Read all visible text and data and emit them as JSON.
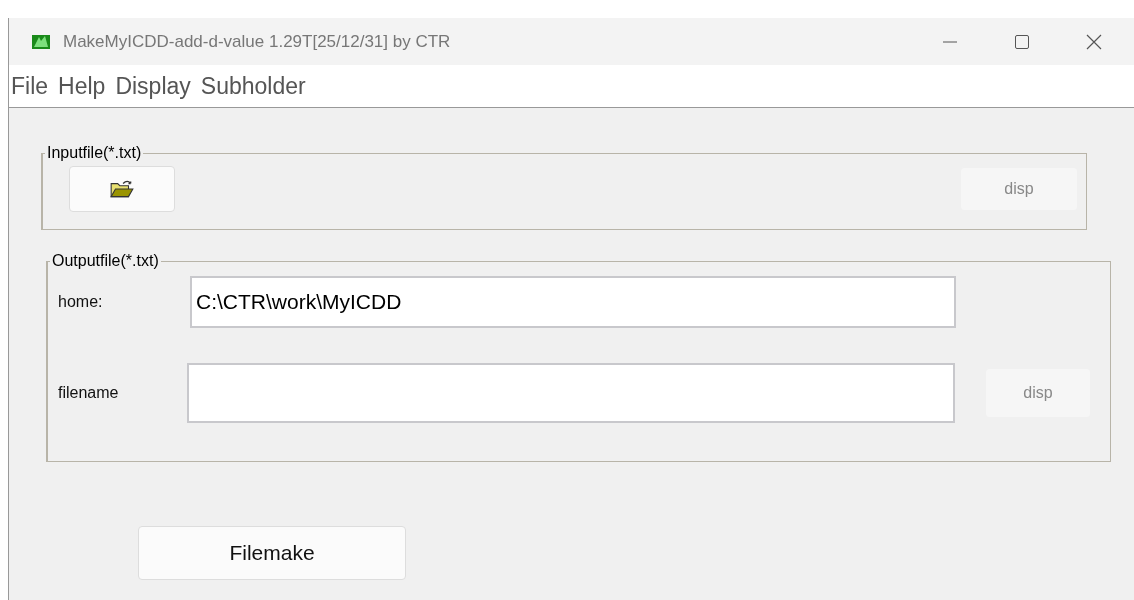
{
  "window": {
    "title": "MakeMyICDD-add-d-value 1.29T[25/12/31] by CTR"
  },
  "menu": [
    "File",
    "Help",
    "Display",
    "Subholder"
  ],
  "input_group": {
    "legend": "Inputfile(*.txt)",
    "disp_button": {
      "label": "disp",
      "disabled": true
    }
  },
  "output_group": {
    "legend": "Outputfile(*.txt)",
    "home": {
      "label": "home:",
      "value": "C:\\CTR\\work\\MyICDD"
    },
    "filename": {
      "label": "filename"
    },
    "disp_button": {
      "label": "disp",
      "disabled": true
    }
  },
  "filemake_button": {
    "label": "Filemake"
  }
}
